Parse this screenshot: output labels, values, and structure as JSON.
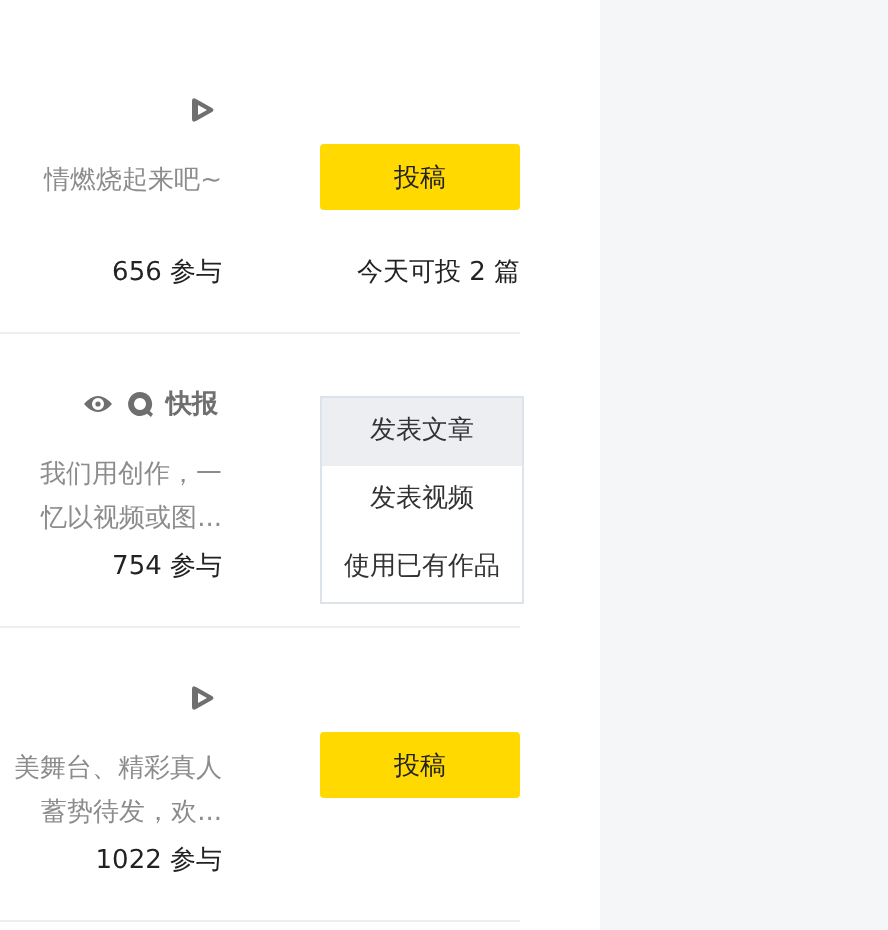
{
  "cards": [
    {
      "icons": [
        {
          "kind": "play"
        }
      ],
      "description": [
        "情燃烧起来吧~"
      ],
      "participants": "656 参与",
      "button": "投稿",
      "quota": "今天可投 2 篇"
    },
    {
      "icons": [
        {
          "kind": "eye"
        },
        {
          "kind": "q"
        }
      ],
      "badge": "快报",
      "description": [
        "我们用创作，一",
        "忆以视频或图..."
      ],
      "participants": "754 参与",
      "menu": [
        {
          "label": "发表文章",
          "selected": true
        },
        {
          "label": "发表视频",
          "selected": false
        },
        {
          "label": "使用已有作品",
          "selected": false
        }
      ]
    },
    {
      "icons": [
        {
          "kind": "play"
        }
      ],
      "description": [
        "美舞台、精彩真人",
        "蓄势待发，欢..."
      ],
      "participants": "1022 参与",
      "button": "投稿"
    }
  ]
}
